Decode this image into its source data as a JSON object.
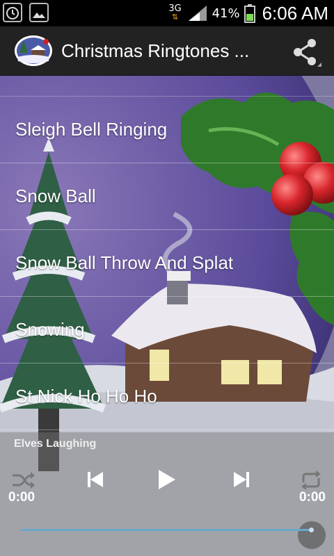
{
  "status_bar": {
    "network_type": "3G",
    "battery_percent": "41%",
    "time": "6:06 AM",
    "icons": [
      "alarm-icon",
      "gallery-icon",
      "signal-icon",
      "battery-icon"
    ]
  },
  "action_bar": {
    "title": "Christmas Ringtones ...",
    "app_icon": "christmas-scene-icon",
    "share_icon": "share-icon"
  },
  "ringtones": [
    {
      "label": "Sleigh Bell Ringing"
    },
    {
      "label": "Snow Ball"
    },
    {
      "label": "Snow Ball Throw And Splat"
    },
    {
      "label": "Snowing"
    },
    {
      "label": "St Nick Ho Ho Ho"
    }
  ],
  "player": {
    "now_playing": "Elves Laughing",
    "elapsed": "0:00",
    "duration": "0:00",
    "progress": 1.0,
    "controls": [
      "shuffle-icon",
      "previous-icon",
      "play-icon",
      "next-icon",
      "repeat-icon"
    ]
  },
  "colors": {
    "sky": "#4c3f8c",
    "holly": "#2f7a2a",
    "berry": "#c8242a",
    "seek": "#6aa8c8"
  }
}
